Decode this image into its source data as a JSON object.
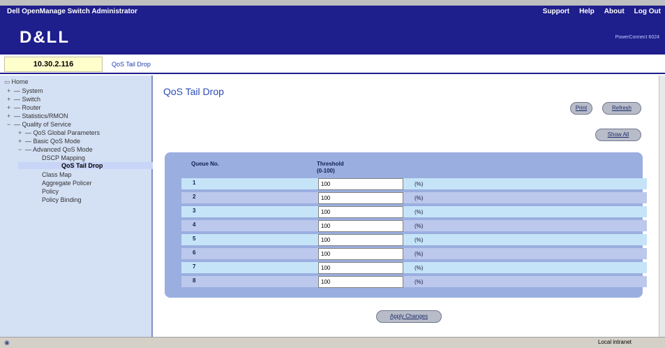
{
  "header": {
    "app_title": "Dell OpenManage Switch Administrator",
    "links": [
      "Support",
      "Help",
      "About",
      "Log Out"
    ]
  },
  "banner": {
    "logo": "D&LL",
    "product": "PowerConnect 6024"
  },
  "address": {
    "ip": "10.30.2.116",
    "breadcrumb": "QoS Tail Drop"
  },
  "tree": {
    "home": "Home",
    "items": [
      "System",
      "Switch",
      "Router",
      "Statistics/RMON",
      "Quality of Service",
      "QoS Global Parameters",
      "Basic QoS Mode",
      "Advanced QoS Mode",
      "DSCP Mapping",
      "QoS Tail Drop",
      "Class Map",
      "Aggregate Policer",
      "Policy",
      "Policy Binding"
    ],
    "selected": "QoS Tail Drop"
  },
  "page": {
    "title": "QoS Tail Drop",
    "buttons": {
      "print": "Print",
      "refresh": "Refresh",
      "show_all": "Show All",
      "apply": "Apply Changes"
    }
  },
  "table": {
    "col_queue": "Queue No.",
    "col_threshold": "Threshold",
    "col_threshold_range": "(0-100)",
    "unit": "(%)",
    "rows": [
      {
        "queue": "1",
        "value": "100"
      },
      {
        "queue": "2",
        "value": "100"
      },
      {
        "queue": "3",
        "value": "100"
      },
      {
        "queue": "4",
        "value": "100"
      },
      {
        "queue": "5",
        "value": "100"
      },
      {
        "queue": "6",
        "value": "100"
      },
      {
        "queue": "7",
        "value": "100"
      },
      {
        "queue": "8",
        "value": "100"
      }
    ]
  },
  "status": {
    "zone": "Local intranet"
  }
}
